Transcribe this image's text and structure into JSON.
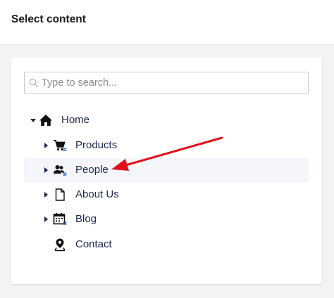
{
  "header": {
    "title": "Select content"
  },
  "search": {
    "placeholder": "Type to search...",
    "value": ""
  },
  "tree": {
    "items": [
      {
        "label": "Home",
        "icon": "home-icon",
        "expanded": true
      },
      {
        "label": "Products",
        "icon": "cart-icon"
      },
      {
        "label": "People",
        "icon": "users-icon"
      },
      {
        "label": "About Us",
        "icon": "document-icon"
      },
      {
        "label": "Blog",
        "icon": "calendar-icon"
      },
      {
        "label": "Contact",
        "icon": "map-pin-icon"
      }
    ]
  },
  "colors": {
    "text": "#1b264f",
    "icon_accent": "#2152a3",
    "annotation_arrow": "#e0111b",
    "highlight_row": "#f5f6fa"
  }
}
